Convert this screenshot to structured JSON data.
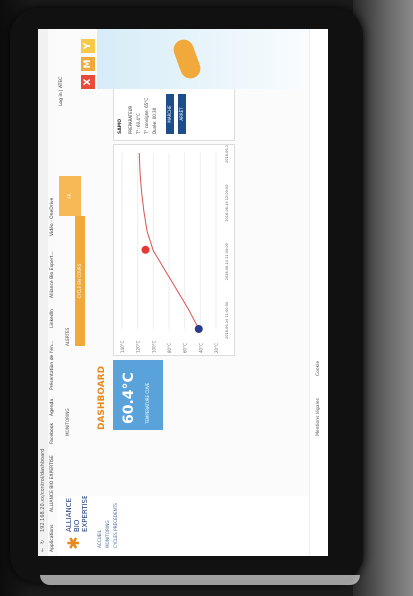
{
  "browser": {
    "address": "192.168.20.xx/control/dashboard",
    "bookmarks": [
      "Applications",
      "ALLIANCE BIO EXPERTISE",
      "Facebook",
      "Agenda",
      "Présentation de l'en...",
      "LinkedIn",
      "Alliance Bio Expert...",
      "Vidéo - OneDrive"
    ],
    "login_text": "Log in | ATEC"
  },
  "brand": {
    "logo_line1": "ALLIANCE",
    "logo_line2": "BIO EXPERTISE"
  },
  "nav": {
    "items": [
      "ACCUEIL",
      "MONITORING",
      "CYCLES PRÉCÉDENTS"
    ]
  },
  "tabs": {
    "main": "MONITORING",
    "alerts": "ALERTES",
    "orange_button": "CYCLE EN COURS"
  },
  "dashboard": {
    "title": "DASHBOARD",
    "temperature_value": "60.4°C",
    "temperature_label": "TEMPERATURE CUVE"
  },
  "panel": {
    "title": "SAMO",
    "rows": [
      "PREPARATEUR",
      "T°: 60.4°C",
      "T° consigne: 65°C",
      "Durée: 00:30"
    ],
    "buttons": [
      "MARCHE",
      "ARRÊT"
    ]
  },
  "chart_data": {
    "type": "line",
    "title": "",
    "y_ticks": [
      "20°C",
      "40°C",
      "60°C",
      "80°C",
      "100°C",
      "120°C",
      "140°C"
    ],
    "x_ticks": [
      "2018-06-14 11:00:00",
      "2018-06-14 11:30:00",
      "2018-06-14 12:00:00",
      "2018-06-14 12:30:00"
    ],
    "ylim": [
      20,
      140
    ],
    "series": [
      {
        "values": [
          42,
          55,
          70,
          85,
          100,
          108,
          112,
          115,
          117,
          118
        ]
      }
    ]
  },
  "footer": {
    "left": "Mentions légales",
    "right": "Cookie"
  },
  "icons": {
    "left": "red-x-icon",
    "mid": "orange-m-icon",
    "right": "yellow-y-icon"
  }
}
